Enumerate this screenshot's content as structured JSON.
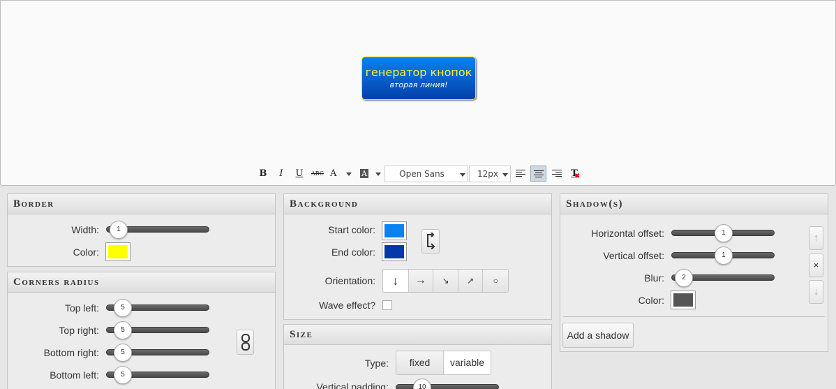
{
  "preview": {
    "button_line1": "генератор кнопок",
    "button_line2": "вторая линия!",
    "colors": {
      "gradient_start": "#0a82f0",
      "gradient_end": "#0440aa",
      "text": "#fff23b",
      "border": "#f0e600"
    }
  },
  "toolbar": {
    "bold": "B",
    "italic": "I",
    "underline": "U",
    "strike": "ABC",
    "font_color": "A",
    "highlight_color": "A",
    "font_family": "Open Sans",
    "font_size": "12px",
    "icons": [
      "bold-icon",
      "italic-icon",
      "underline-icon",
      "strikethrough-icon",
      "text-color-icon",
      "background-color-icon",
      "align-left-icon",
      "align-center-icon",
      "align-right-icon",
      "clear-format-icon"
    ],
    "active_alignment": "center"
  },
  "border": {
    "title": "Border",
    "width_label": "Width:",
    "width_value": "1",
    "color_label": "Color:",
    "color": "#ffff00"
  },
  "corners": {
    "title": "Corners radius",
    "rows": [
      {
        "label": "Top left:",
        "value": "5"
      },
      {
        "label": "Top right:",
        "value": "5"
      },
      {
        "label": "Bottom right:",
        "value": "5"
      },
      {
        "label": "Bottom left:",
        "value": "5"
      }
    ],
    "link_icon": "chain-link-icon"
  },
  "background": {
    "title": "Background",
    "start_label": "Start color:",
    "start_color": "#0a82f0",
    "end_label": "End color:",
    "end_color": "#0438a8",
    "swap_icon": "swap-icon",
    "orientation_label": "Orientation:",
    "orientations": [
      "↓",
      "→",
      "↘",
      "↗",
      "○"
    ],
    "selected_orientation": "↓",
    "wave_label": "Wave effect?"
  },
  "size": {
    "title": "Size",
    "type_label": "Type:",
    "type_options": [
      "fixed",
      "variable"
    ],
    "type_selected": "variable",
    "vpad_label": "Vertical padding:",
    "vpad_value": "10"
  },
  "shadows": {
    "title": "Shadow(s)",
    "h_label": "Horizontal offset:",
    "h_value": "1",
    "v_label": "Vertical offset:",
    "v_value": "1",
    "blur_label": "Blur:",
    "blur_value": "2",
    "color_label": "Color:",
    "color": "#555555",
    "up": "↑",
    "remove": "×",
    "down": "↓",
    "add_label": "Add a shadow"
  }
}
